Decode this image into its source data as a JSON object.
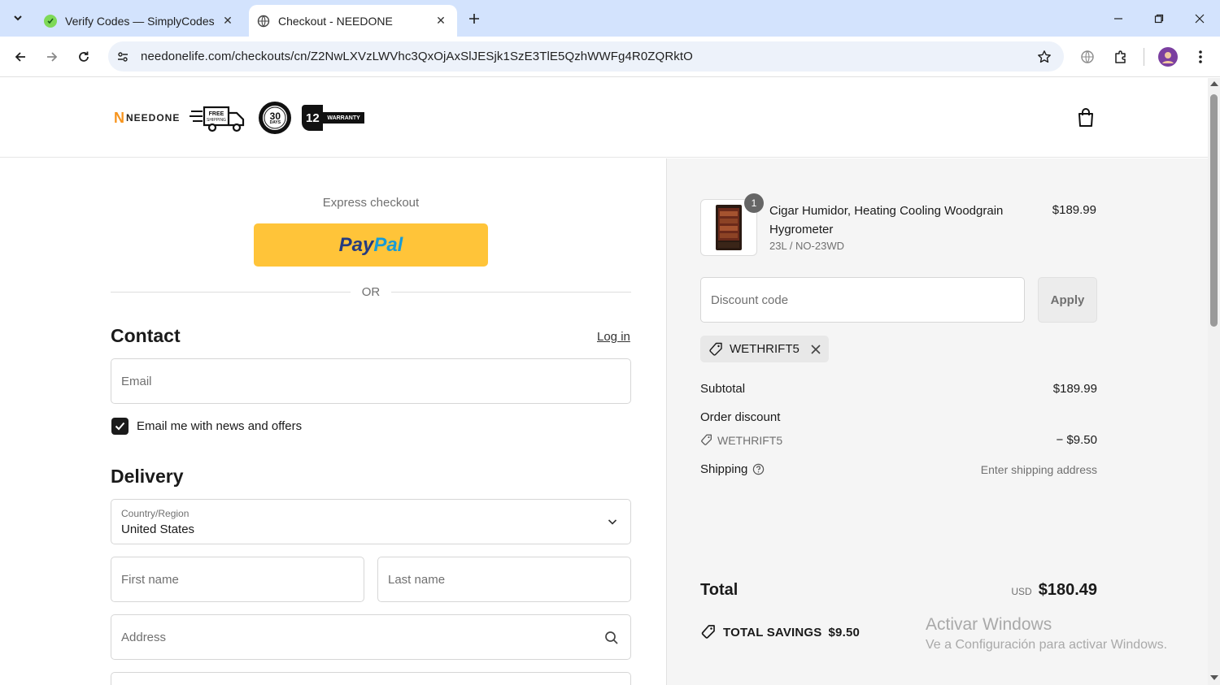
{
  "browser": {
    "tabs": [
      {
        "title": "Verify Codes — SimplyCodes",
        "active": false
      },
      {
        "title": "Checkout - NEEDONE",
        "active": true
      }
    ],
    "url": "needonelife.com/checkouts/cn/Z2NwLXVzLWVhc3QxOjAxSlJESjk1SzE3TlE5QzhWWFg4R0ZQRktO"
  },
  "header": {
    "logo_text": "NEEDONE",
    "badge_free_shipping": "FREE SHIPPING",
    "badge_days_number": "30",
    "badge_days_label": "DAYS",
    "badge_warranty_number": "12",
    "badge_warranty_label": "WARRANTY"
  },
  "checkout": {
    "express_label": "Express checkout",
    "paypal_pay": "Pay",
    "paypal_pal": "Pal",
    "or_label": "OR",
    "contact_heading": "Contact",
    "login_link": "Log in",
    "email_placeholder": "Email",
    "news_checkbox_label": "Email me with news and offers",
    "news_checked": true,
    "delivery_heading": "Delivery",
    "country_label": "Country/Region",
    "country_value": "United States",
    "first_name_placeholder": "First name",
    "last_name_placeholder": "Last name",
    "address_placeholder": "Address"
  },
  "summary": {
    "product": {
      "name": "Cigar Humidor, Heating Cooling Woodgrain Hygrometer",
      "variant": "23L / NO-23WD",
      "price": "$189.99",
      "quantity": "1"
    },
    "discount_placeholder": "Discount code",
    "apply_label": "Apply",
    "applied_code": "WETHRIFT5",
    "subtotal_label": "Subtotal",
    "subtotal_value": "$189.99",
    "order_discount_label": "Order discount",
    "order_discount_code": "WETHRIFT5",
    "order_discount_value": "− $9.50",
    "shipping_label": "Shipping",
    "shipping_value": "Enter shipping address",
    "total_label": "Total",
    "total_currency": "USD",
    "total_value": "$180.49",
    "savings_label": "TOTAL SAVINGS",
    "savings_value": "$9.50"
  },
  "watermark": {
    "line1": "Activar Windows",
    "line2": "Ve a Configuración para activar Windows."
  },
  "colors": {
    "paypal_yellow": "#ffc439",
    "tabbar_blue": "#d3e3fd",
    "summary_bg": "#f5f5f5"
  }
}
